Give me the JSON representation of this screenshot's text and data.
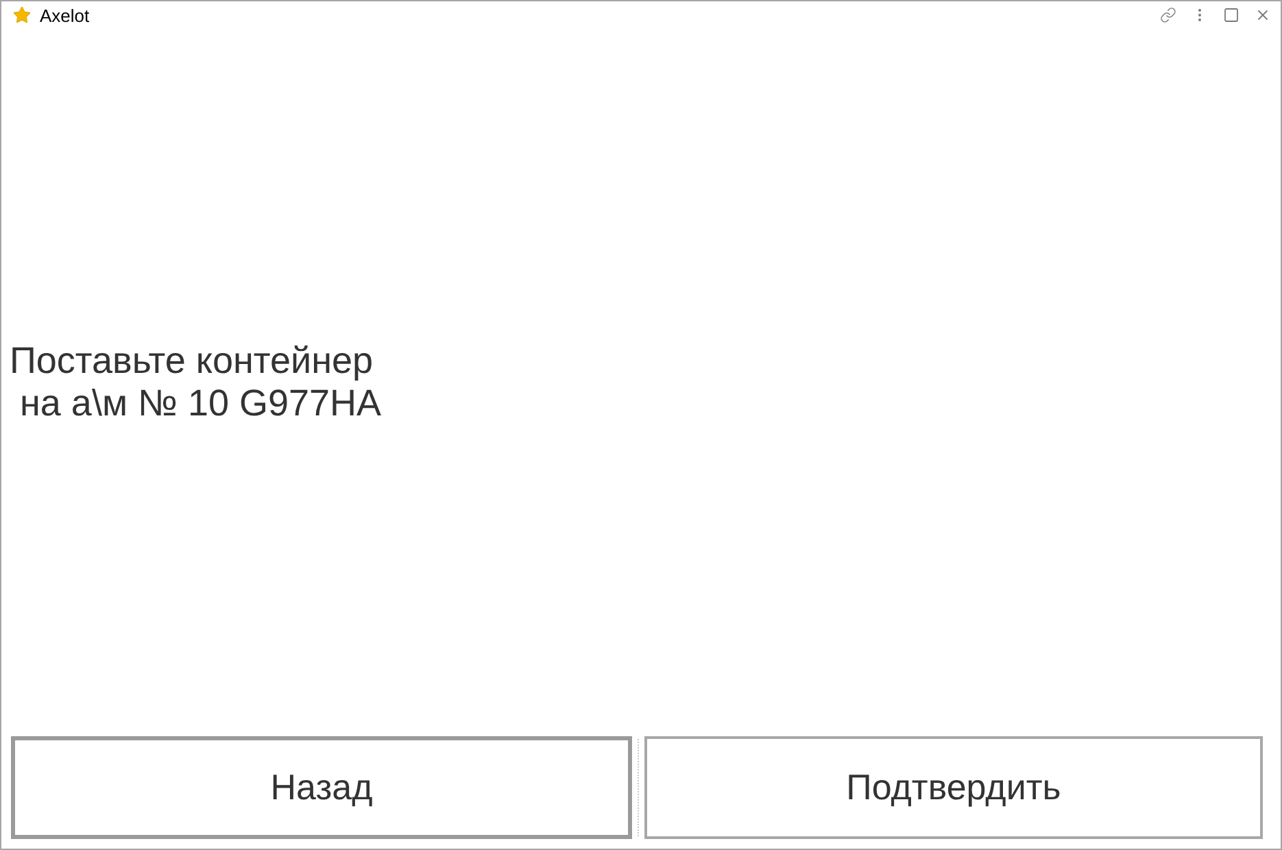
{
  "window": {
    "title": "Axelot"
  },
  "message": [
    "Поставьте контейнер",
    " на а\\м № 10 G977HA"
  ],
  "buttons": [
    {
      "label": "Назад",
      "focused": true
    },
    {
      "label": "Подтвердить",
      "focused": false
    }
  ]
}
